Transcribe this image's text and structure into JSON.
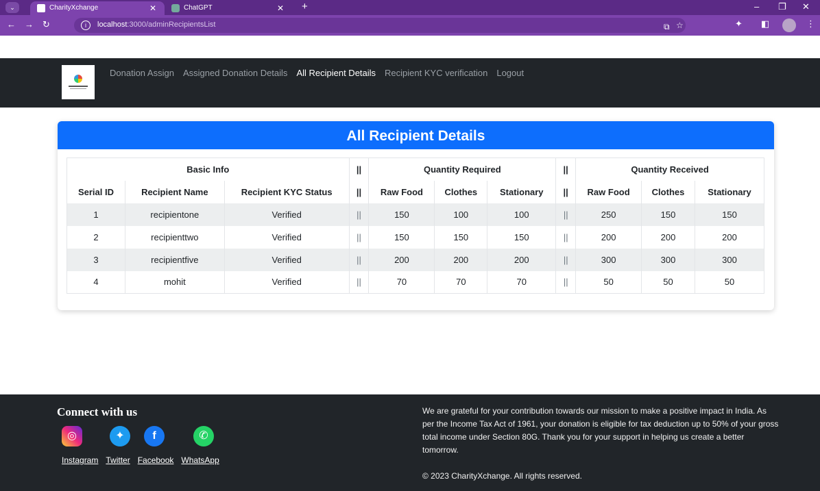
{
  "browser": {
    "tabs": [
      {
        "title": "CharityXchange",
        "active": true
      },
      {
        "title": "ChatGPT",
        "active": false
      }
    ],
    "url_host": "localhost",
    "url_path": ":3000/adminRecipientsList"
  },
  "nav": {
    "links": [
      {
        "label": "Donation Assign",
        "active": false
      },
      {
        "label": "Assigned Donation Details",
        "active": false
      },
      {
        "label": "All Recipient Details",
        "active": true
      },
      {
        "label": "Recipient KYC verification",
        "active": false
      },
      {
        "label": "Logout",
        "active": false
      }
    ]
  },
  "card": {
    "title": "All Recipient Details"
  },
  "table": {
    "groups": {
      "basic": "Basic Info",
      "sep": "||",
      "required": "Quantity Required",
      "received": "Quantity Received"
    },
    "headers": {
      "serial": "Serial ID",
      "name": "Recipient Name",
      "kyc": "Recipient KYC Status",
      "sep": "||",
      "raw": "Raw Food",
      "clothes": "Clothes",
      "stationary": "Stationary"
    },
    "rows": [
      {
        "id": "1",
        "name": "recipientone",
        "kyc": "Verified",
        "sep": "||",
        "req_raw": "150",
        "req_clothes": "100",
        "req_stat": "100",
        "rec_raw": "250",
        "rec_clothes": "150",
        "rec_stat": "150"
      },
      {
        "id": "2",
        "name": "recipienttwo",
        "kyc": "Verified",
        "sep": "||",
        "req_raw": "150",
        "req_clothes": "150",
        "req_stat": "150",
        "rec_raw": "200",
        "rec_clothes": "200",
        "rec_stat": "200"
      },
      {
        "id": "3",
        "name": "recipientfive",
        "kyc": "Verified",
        "sep": "||",
        "req_raw": "200",
        "req_clothes": "200",
        "req_stat": "200",
        "rec_raw": "300",
        "rec_clothes": "300",
        "rec_stat": "300"
      },
      {
        "id": "4",
        "name": "mohit",
        "kyc": "Verified",
        "sep": "||",
        "req_raw": "70",
        "req_clothes": "70",
        "req_stat": "70",
        "rec_raw": "50",
        "rec_clothes": "50",
        "rec_stat": "50"
      }
    ]
  },
  "footer": {
    "connect_title": "Connect with us",
    "links": [
      "Instagram",
      "Twitter",
      "Facebook",
      "WhatsApp"
    ],
    "about": "We are grateful for your contribution towards our mission to make a positive impact in India. As per the Income Tax Act of 1961, your donation is eligible for tax deduction up to 50% of your gross total income under Section 80G. Thank you for your support in helping us create a better tomorrow.",
    "copyright": "© 2023 CharityXchange. All rights reserved."
  },
  "colors": {
    "tabbar": "#5b2a86",
    "addressbar": "#7d43ad",
    "navbar": "#212529",
    "card_header": "#0d6efd",
    "footer": "#212529"
  }
}
